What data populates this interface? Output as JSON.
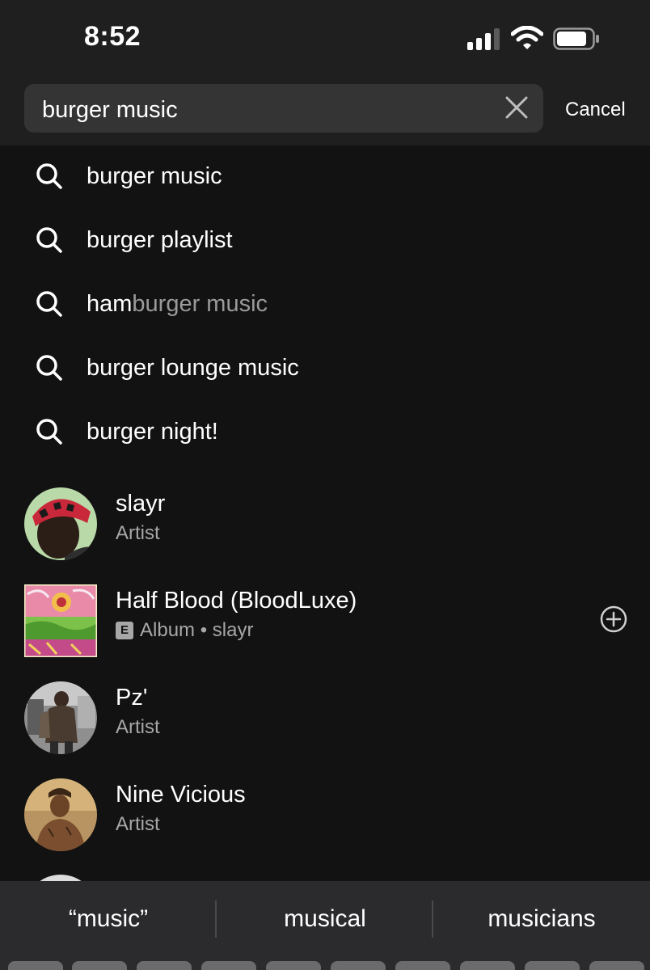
{
  "status_bar": {
    "time": "8:52",
    "icons": [
      "signal-icon",
      "wifi-icon",
      "battery-icon"
    ]
  },
  "search": {
    "query": "burger music",
    "clear_icon": "close-icon",
    "cancel_label": "Cancel"
  },
  "suggestions": [
    {
      "icon": "search-icon",
      "bold": "",
      "rest": "burger music",
      "style": "dimmed"
    },
    {
      "icon": "search-icon",
      "bold": "burger playlist",
      "rest": ""
    },
    {
      "icon": "search-icon",
      "bold": "ham",
      "rest": "burger music"
    },
    {
      "icon": "search-icon",
      "bold": "burger lounge music",
      "rest": ""
    },
    {
      "icon": "search-icon",
      "bold": "burger night!",
      "rest": ""
    }
  ],
  "results": [
    {
      "title": "slayr",
      "subtitle": "Artist",
      "shape": "round"
    },
    {
      "title": "Half Blood (BloodLuxe)",
      "badge": "E",
      "subtitle": "Album • slayr",
      "shape": "square",
      "action_icon": "add-circle-icon"
    },
    {
      "title": "Pz'",
      "subtitle": "Artist",
      "shape": "round"
    },
    {
      "title": "Nine Vicious",
      "subtitle": "Artist",
      "shape": "round"
    }
  ],
  "keyboard": {
    "predictions": [
      "“music”",
      "musical",
      "musicians"
    ]
  },
  "colors": {
    "background": "#121212",
    "header": "#1f1f1f",
    "search_field": "#343434",
    "secondary_text": "#a7a7a7"
  }
}
